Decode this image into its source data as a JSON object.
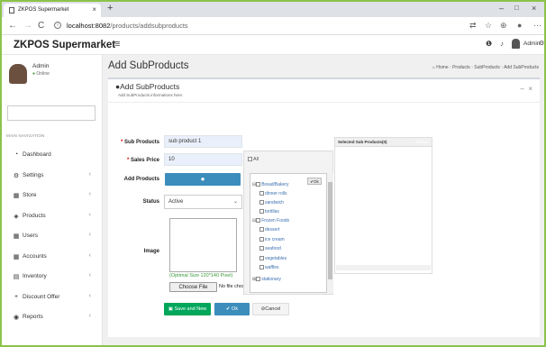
{
  "browser": {
    "tab_title": "ZKPOS Supermarket",
    "url_host": "localhost:8082",
    "url_path": "/products/addsubproducts"
  },
  "header": {
    "brand": "ZKPOS Supermarket",
    "notif_count": "",
    "user_label": "Admin"
  },
  "sidebar": {
    "user_name": "Admin",
    "user_status": "Online",
    "section_label": "MAIN NAVIGATION",
    "items": [
      {
        "label": "Dashboard",
        "icon": "dashboard-icon",
        "chevron": ""
      },
      {
        "label": "Settings",
        "icon": "gear-icon",
        "chevron": "‹"
      },
      {
        "label": "Store",
        "icon": "store-icon",
        "chevron": "‹"
      },
      {
        "label": "Products",
        "icon": "tag-icon",
        "chevron": "‹"
      },
      {
        "label": "Users",
        "icon": "users-icon",
        "chevron": "‹"
      },
      {
        "label": "Accounts",
        "icon": "accounts-icon",
        "chevron": "‹"
      },
      {
        "label": "Inventory",
        "icon": "inventory-icon",
        "chevron": "‹"
      },
      {
        "label": "Discount Offer",
        "icon": "plus-icon",
        "chevron": "‹"
      },
      {
        "label": "Reports",
        "icon": "eye-icon",
        "chevron": "‹"
      }
    ]
  },
  "page": {
    "title": "Add SubProducts",
    "breadcrumb": [
      "Home",
      "Products",
      "SubProducts",
      "Add SubProducts"
    ]
  },
  "form": {
    "box_title": "Add SubProducts",
    "box_subtitle": "Add SubProducts informations here.",
    "sub_products_label": "Sub Products",
    "sub_products_value": "sub product 1",
    "sales_price_label": "Sales Price",
    "sales_price_value": "10",
    "add_products_label": "Add Products",
    "status_label": "Status",
    "status_value": "Active",
    "image_label": "Image",
    "image_hint": "(Optimal Size 120*140 Pixel)",
    "file_button": "Choose File",
    "file_status": "No file chosen",
    "all_label": "All",
    "ok_mini": "✔Ok",
    "selected_title": "Selected Sub Products(0)",
    "clear_label": "✐Clear",
    "save_new": "Save and New",
    "ok": "Ok",
    "cancel": "Cancel"
  },
  "tree": [
    {
      "label": "Bread/Bakery",
      "level": 0,
      "toggle": "⊟"
    },
    {
      "label": "dinner rolls",
      "level": 1,
      "toggle": ""
    },
    {
      "label": "sandwich",
      "level": 1,
      "toggle": ""
    },
    {
      "label": "tortillas",
      "level": 1,
      "toggle": ""
    },
    {
      "label": "Frozen Foods",
      "level": 0,
      "toggle": "⊟"
    },
    {
      "label": "dessert",
      "level": 1,
      "toggle": ""
    },
    {
      "label": "ice cream",
      "level": 1,
      "toggle": ""
    },
    {
      "label": "seafood",
      "level": 1,
      "toggle": ""
    },
    {
      "label": "vegetables",
      "level": 1,
      "toggle": ""
    },
    {
      "label": "waffles",
      "level": 1,
      "toggle": ""
    },
    {
      "label": "stationary",
      "level": 0,
      "toggle": "⊞"
    }
  ],
  "colors": {
    "primary": "#3c8dbc",
    "success": "#00a65a",
    "hint": "#3a9a3a",
    "required": "#dd0000",
    "frame": "#8bc34a"
  }
}
